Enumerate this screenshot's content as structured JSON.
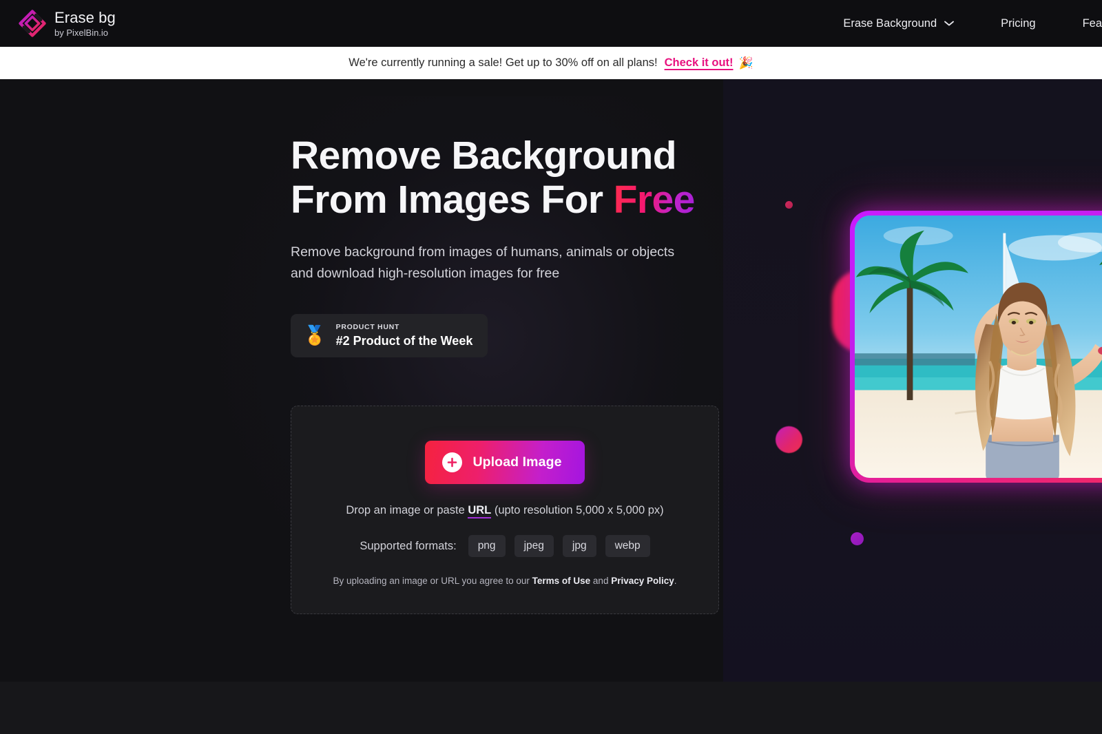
{
  "header": {
    "brand": {
      "name": "Erase bg",
      "tagline": "by PixelBin.io",
      "logo_icon": "erasebg-diamond-logo-icon"
    },
    "nav": [
      {
        "label": "Erase Background",
        "has_dropdown": true,
        "dropdown_icon": "chevron-down-icon"
      },
      {
        "label": "Pricing",
        "has_dropdown": false
      },
      {
        "label": "Fea",
        "has_dropdown": false,
        "truncated": true
      }
    ]
  },
  "banner": {
    "text": "We're currently running a sale! Get up to 30% off on all plans!",
    "link_label": "Check it out!",
    "emoji": "🎉",
    "background": "#ffffff",
    "link_color": "#e8117f"
  },
  "hero": {
    "headline_line1": "Remove Background",
    "headline_line2_prefix": "From Images For ",
    "headline_highlight": "Free",
    "subhead_line1": "Remove background from images of humans, animals or objects",
    "subhead_line2": "and download high-resolution images for free",
    "badge": {
      "medal_icon": "🏅",
      "kicker": "PRODUCT HUNT",
      "title": "#2 Product of the Week"
    }
  },
  "upload": {
    "button_label": "Upload Image",
    "button_icon": "plus-circle-icon",
    "drop_prefix": "Drop an image or paste ",
    "drop_link": "URL",
    "drop_suffix": " (upto resolution 5,000 x 5,000 px)",
    "formats_label": "Supported formats:",
    "formats": [
      "png",
      "jpeg",
      "jpg",
      "webp"
    ],
    "legal_prefix": "By uploading an image or URL you agree to our ",
    "legal_terms": "Terms of Use",
    "legal_and": " and ",
    "legal_privacy": "Privacy Policy",
    "legal_suffix": "."
  },
  "visual": {
    "photo_alt": "woman with long wavy hair on a beach with palm trees",
    "frame_gradient_start": "#c81bff",
    "frame_gradient_end": "#f12a5e"
  },
  "colors": {
    "page_bg": "#111114",
    "header_bg": "#0e0e11",
    "card_bg": "#1b1b1e",
    "accent_pink": "#e8117f",
    "accent_purple": "#a415e0"
  }
}
